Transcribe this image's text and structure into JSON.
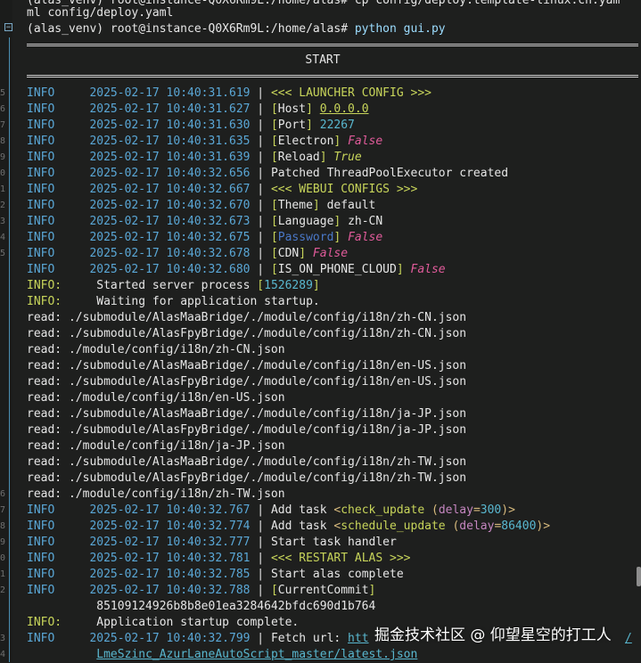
{
  "prompt": {
    "cut_line": "(alas_venv) root@instance-Q0X6Rm9L:/home/alas# cp config/deploy.template-linux.cn.yam",
    "cut_line_cont": "ml config/deploy.yaml",
    "user_host": "(alas_venv) root@instance-Q0X6Rm9L:/home/alas#",
    "command": "python gui.py"
  },
  "banner": {
    "label": "START"
  },
  "gutter_numbers": [
    "5",
    "6",
    "7",
    "8",
    "9",
    "0",
    "1",
    "2",
    "3",
    "4",
    "5",
    "",
    "",
    "",
    "",
    "",
    "",
    "",
    "",
    "",
    "",
    "",
    "",
    "",
    "",
    "6",
    "7",
    "8",
    "9",
    "0",
    "1",
    "2",
    "",
    "",
    "3",
    "4"
  ],
  "log_lines": [
    {
      "level": "INFO",
      "time": "2025-02-17 10:40:31.619",
      "segs": [
        {
          "t": "<<< LAUNCHER CONFIG >>>",
          "c": "green"
        }
      ]
    },
    {
      "level": "INFO",
      "time": "2025-02-17 10:40:31.627",
      "segs": [
        {
          "t": "[",
          "c": "green"
        },
        {
          "t": "Host",
          "c": ""
        },
        {
          "t": "] ",
          "c": "green"
        },
        {
          "t": "0.0.0.0",
          "c": "green underline"
        }
      ]
    },
    {
      "level": "INFO",
      "time": "2025-02-17 10:40:31.630",
      "segs": [
        {
          "t": "[",
          "c": "green"
        },
        {
          "t": "Port",
          "c": ""
        },
        {
          "t": "] ",
          "c": "green"
        },
        {
          "t": "22267",
          "c": "num"
        }
      ]
    },
    {
      "level": "INFO",
      "time": "2025-02-17 10:40:31.635",
      "segs": [
        {
          "t": "[",
          "c": "green"
        },
        {
          "t": "Electron",
          "c": ""
        },
        {
          "t": "] ",
          "c": "green"
        },
        {
          "t": "False",
          "c": "bool"
        }
      ]
    },
    {
      "level": "INFO",
      "time": "2025-02-17 10:40:31.639",
      "segs": [
        {
          "t": "[",
          "c": "green"
        },
        {
          "t": "Reload",
          "c": ""
        },
        {
          "t": "] ",
          "c": "green"
        },
        {
          "t": "True",
          "c": "green bool-i"
        }
      ]
    },
    {
      "level": "INFO",
      "time": "2025-02-17 10:40:32.656",
      "segs": [
        {
          "t": "Patched ThreadPoolExecutor created",
          "c": ""
        }
      ]
    },
    {
      "level": "INFO",
      "time": "2025-02-17 10:40:32.667",
      "segs": [
        {
          "t": "<<< WEBUI CONFIGS >>>",
          "c": "green"
        }
      ]
    },
    {
      "level": "INFO",
      "time": "2025-02-17 10:40:32.670",
      "segs": [
        {
          "t": "[",
          "c": "green"
        },
        {
          "t": "Theme",
          "c": ""
        },
        {
          "t": "] ",
          "c": "green"
        },
        {
          "t": "default",
          "c": ""
        }
      ]
    },
    {
      "level": "INFO",
      "time": "2025-02-17 10:40:32.673",
      "segs": [
        {
          "t": "[",
          "c": "green"
        },
        {
          "t": "Language",
          "c": ""
        },
        {
          "t": "] ",
          "c": "green"
        },
        {
          "t": "zh-CN",
          "c": ""
        }
      ]
    },
    {
      "level": "INFO",
      "time": "2025-02-17 10:40:32.675",
      "segs": [
        {
          "t": "[",
          "c": "green"
        },
        {
          "t": "Password",
          "c": "blue-text"
        },
        {
          "t": "] ",
          "c": "green"
        },
        {
          "t": "False",
          "c": "bool"
        }
      ]
    },
    {
      "level": "INFO",
      "time": "2025-02-17 10:40:32.678",
      "segs": [
        {
          "t": "[",
          "c": "green"
        },
        {
          "t": "CDN",
          "c": ""
        },
        {
          "t": "] ",
          "c": "green"
        },
        {
          "t": "False",
          "c": "bool"
        }
      ]
    },
    {
      "level": "INFO",
      "time": "2025-02-17 10:40:32.680",
      "segs": [
        {
          "t": "[",
          "c": "green"
        },
        {
          "t": "IS_ON_PHONE_CLOUD",
          "c": ""
        },
        {
          "t": "] ",
          "c": "green"
        },
        {
          "t": "False",
          "c": "bool"
        }
      ]
    }
  ],
  "uvicorn_lines": [
    {
      "level": "INFO:",
      "segs": [
        {
          "t": "Started server process ",
          "c": ""
        },
        {
          "t": "[",
          "c": "green"
        },
        {
          "t": "1526289",
          "c": "num"
        },
        {
          "t": "]",
          "c": "green"
        }
      ]
    },
    {
      "level": "INFO:",
      "segs": [
        {
          "t": "Waiting for application startup.",
          "c": ""
        }
      ]
    }
  ],
  "read_lines": [
    "read: ./submodule/AlasMaaBridge/./module/config/i18n/zh-CN.json",
    "read: ./submodule/AlasFpyBridge/./module/config/i18n/zh-CN.json",
    "read: ./module/config/i18n/zh-CN.json",
    "read: ./submodule/AlasMaaBridge/./module/config/i18n/en-US.json",
    "read: ./submodule/AlasFpyBridge/./module/config/i18n/en-US.json",
    "read: ./module/config/i18n/en-US.json",
    "read: ./submodule/AlasMaaBridge/./module/config/i18n/ja-JP.json",
    "read: ./submodule/AlasFpyBridge/./module/config/i18n/ja-JP.json",
    "read: ./module/config/i18n/ja-JP.json",
    "read: ./submodule/AlasMaaBridge/./module/config/i18n/zh-TW.json",
    "read: ./submodule/AlasFpyBridge/./module/config/i18n/zh-TW.json",
    "read: ./module/config/i18n/zh-TW.json"
  ],
  "log_lines_2": [
    {
      "level": "INFO",
      "time": "2025-02-17 10:40:32.767",
      "segs": [
        {
          "t": "Add task ",
          "c": ""
        },
        {
          "t": "<",
          "c": "mustard"
        },
        {
          "t": "check_update",
          "c": "green"
        },
        {
          "t": " (",
          "c": "mustard"
        },
        {
          "t": "delay",
          "c": "purple"
        },
        {
          "t": "=",
          "c": "mustard"
        },
        {
          "t": "300",
          "c": "num"
        },
        {
          "t": ")>",
          "c": "mustard"
        }
      ]
    },
    {
      "level": "INFO",
      "time": "2025-02-17 10:40:32.774",
      "segs": [
        {
          "t": "Add task ",
          "c": ""
        },
        {
          "t": "<",
          "c": "mustard"
        },
        {
          "t": "schedule_update",
          "c": "green"
        },
        {
          "t": " (",
          "c": "mustard"
        },
        {
          "t": "delay",
          "c": "purple"
        },
        {
          "t": "=",
          "c": "mustard"
        },
        {
          "t": "86400",
          "c": "num"
        },
        {
          "t": ")>",
          "c": "mustard"
        }
      ]
    },
    {
      "level": "INFO",
      "time": "2025-02-17 10:40:32.777",
      "segs": [
        {
          "t": "Start task handler",
          "c": ""
        }
      ]
    },
    {
      "level": "INFO",
      "time": "2025-02-17 10:40:32.781",
      "segs": [
        {
          "t": "<<< RESTART ALAS >>>",
          "c": "green"
        }
      ]
    },
    {
      "level": "INFO",
      "time": "2025-02-17 10:40:32.785",
      "segs": [
        {
          "t": "Start alas complete",
          "c": ""
        }
      ]
    },
    {
      "level": "INFO",
      "time": "2025-02-17 10:40:32.788",
      "segs": [
        {
          "t": "[",
          "c": "green"
        },
        {
          "t": "CurrentCommit",
          "c": ""
        },
        {
          "t": "]",
          "c": "green"
        }
      ]
    }
  ],
  "commit_hash": "85109124926b8b8e01ea3284642bfdc690d1b764",
  "startup_complete": {
    "level": "INFO:",
    "text": "Application startup complete."
  },
  "fetch_line": {
    "level": "INFO",
    "time": "2025-02-17 10:40:32.799",
    "prefix": "Fetch url: ",
    "url_visible": "htt",
    "url_tail": "/",
    "url_cont": "LmeSzinc_AzurLaneAutoScript_master/latest.json"
  },
  "watermark": "掘金技术社区 @ 仰望星空的打工人"
}
